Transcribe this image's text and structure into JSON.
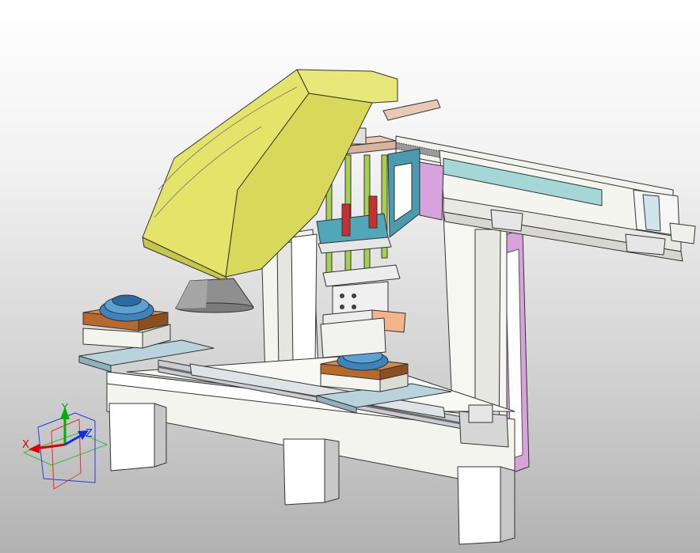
{
  "viewport": {
    "background_top": "#ffffff",
    "background_bottom": "#b2b2b2"
  },
  "triad": {
    "x_label": "X",
    "y_label": "Y",
    "z_label": "Z",
    "x_color": "#e00000",
    "y_color": "#00b000",
    "z_color": "#1030e0"
  },
  "palette": {
    "laser_housing": "#e4e46a",
    "frame": "#f4f4ef",
    "plate": "#b9d3dc",
    "fixture_copper": "#b86a2c",
    "part_blue": "#3c84c0",
    "rail": "#c9cdd1",
    "purple_panel": "#d8a3dc",
    "green_rod": "#a8d050",
    "red_cylinder": "#c83030",
    "teal_block": "#4fa7b8"
  }
}
